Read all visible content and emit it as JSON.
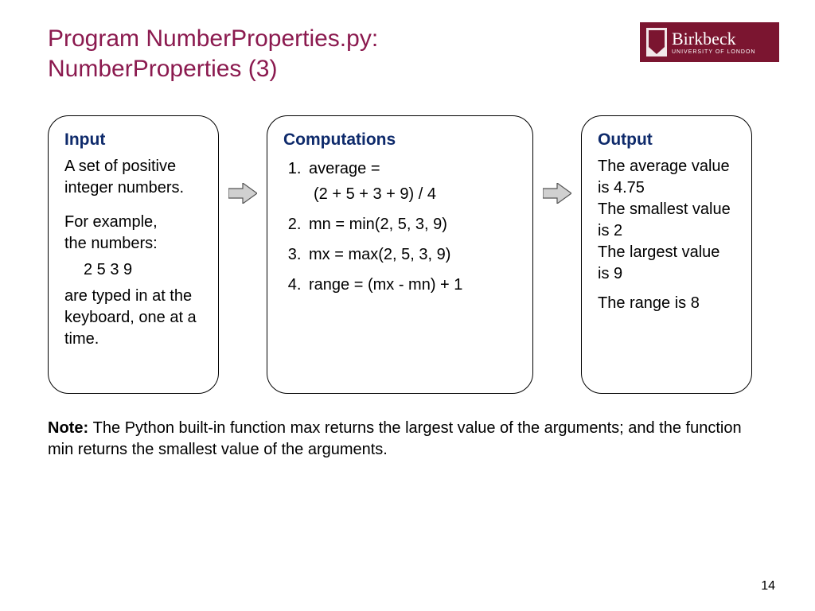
{
  "title_line1": "Program NumberProperties.py:",
  "title_line2_a": "NumberProperties ",
  "title_line2_b": "(3)",
  "logo": {
    "main": "Birkbeck",
    "sub": "UNIVERSITY OF LONDON"
  },
  "input": {
    "title": "Input",
    "p1": "A  set of positive integer numbers.",
    "p2a": "For example,",
    "p2b": "the numbers:",
    "nums": "2   5   3   9",
    "p3": "are typed in at the keyboard, one at a time."
  },
  "comp": {
    "title": "Computations",
    "items": [
      {
        "a": "average =",
        "b": "(2 + 5 + 3 + 9) / 4"
      },
      {
        "a": "mn = min(2, 5, 3, 9)"
      },
      {
        "a": "mx = max(2, 5, 3, 9)"
      },
      {
        "a": "range = (mx - mn)  + 1"
      }
    ]
  },
  "output": {
    "title": "Output",
    "l1": "The average value is 4.75",
    "l2": "The smallest value is 2",
    "l3": "The largest value is 9",
    "l4": "The range is 8"
  },
  "note_label": "Note: ",
  "note_text": "The Python built-in function max returns the largest value of the arguments; and the function min returns the smallest value of the arguments.",
  "page": "14"
}
